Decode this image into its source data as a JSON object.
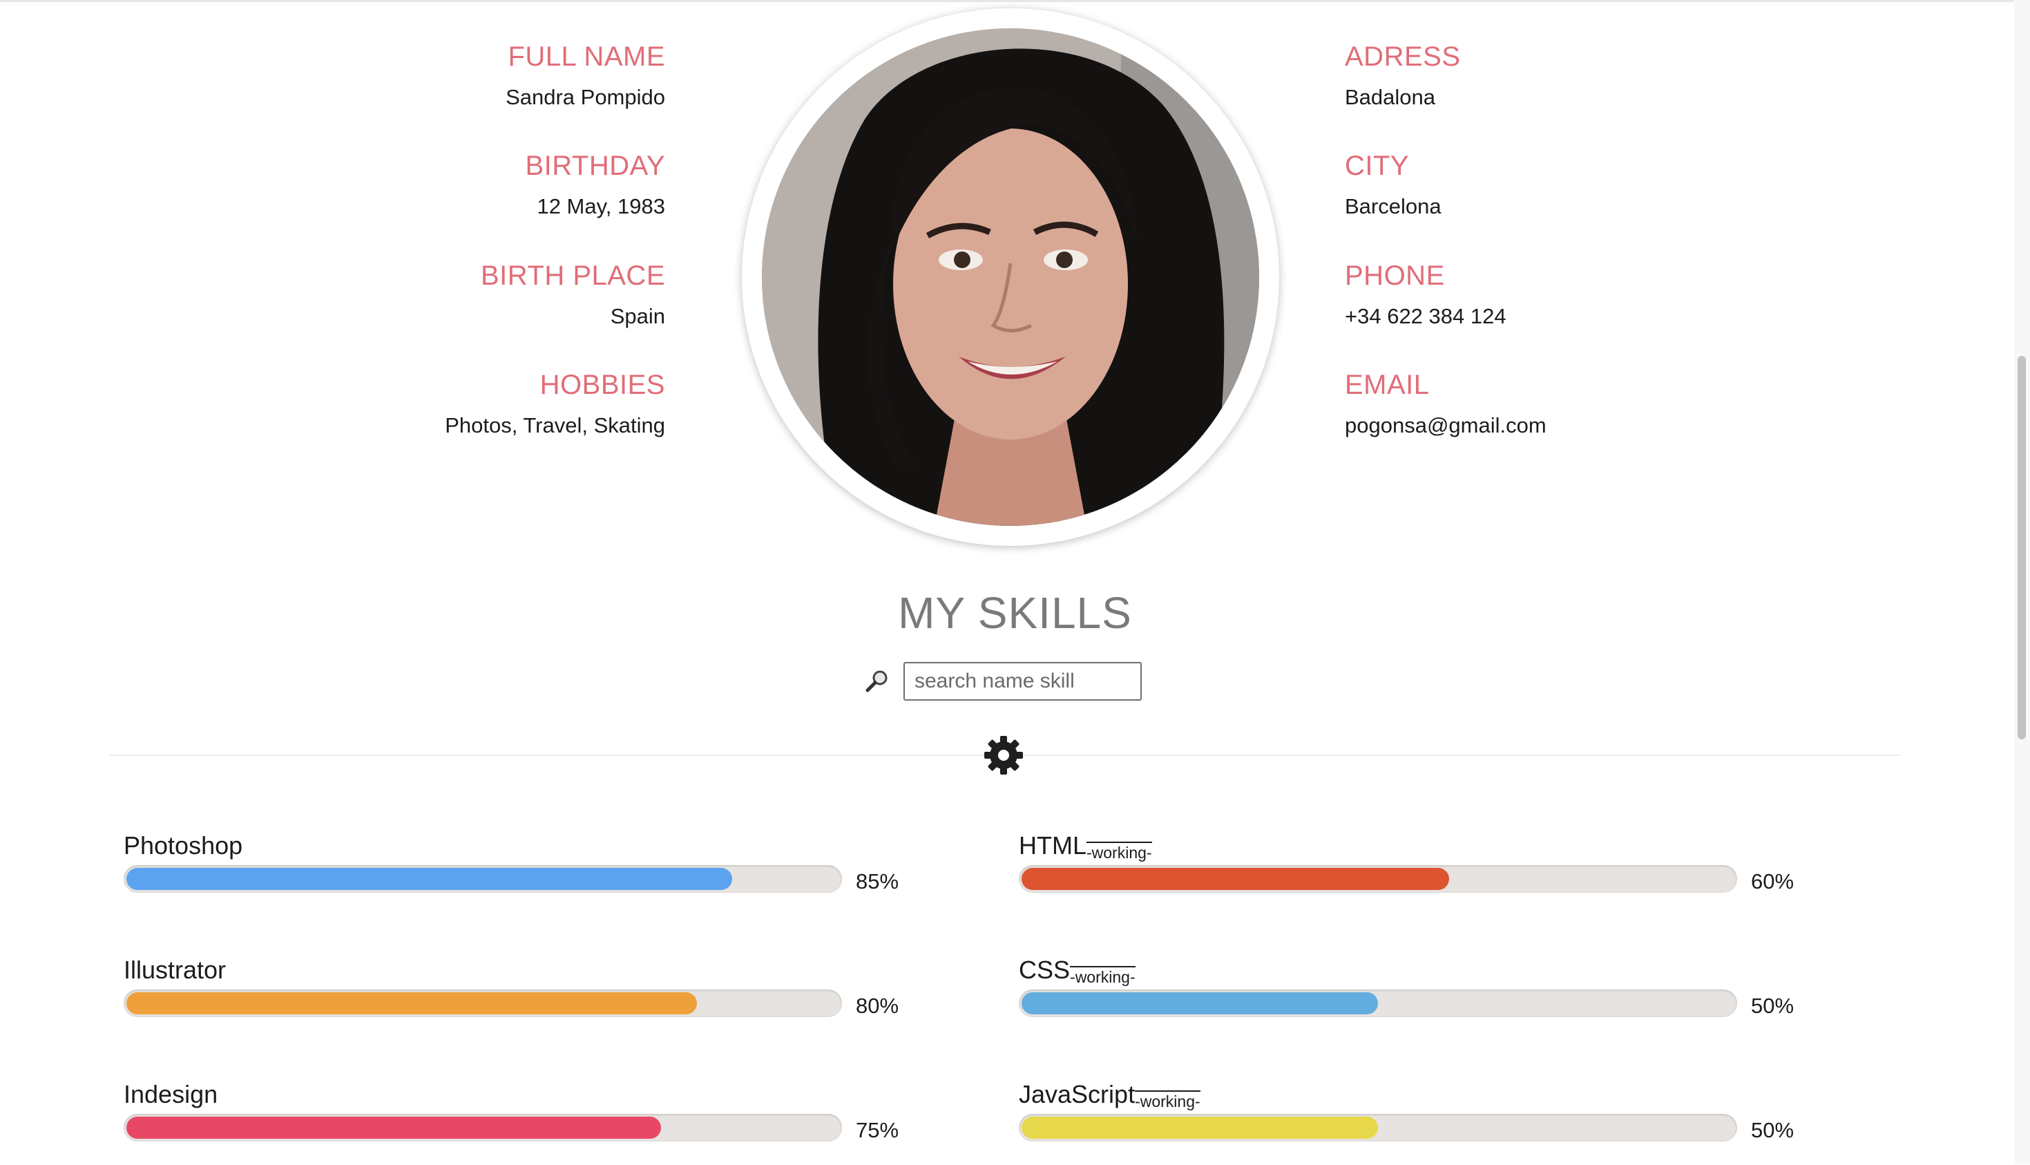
{
  "profile": {
    "left": [
      {
        "label": "FULL NAME",
        "value": "Sandra Pompido"
      },
      {
        "label": "BIRTHDAY",
        "value": "12 May, 1983"
      },
      {
        "label": "BIRTH PLACE",
        "value": "Spain"
      },
      {
        "label": "HOBBIES",
        "value": "Photos, Travel, Skating"
      }
    ],
    "right": [
      {
        "label": "ADRESS",
        "value": "Badalona"
      },
      {
        "label": "CITY",
        "value": "Barcelona"
      },
      {
        "label": "PHONE",
        "value": "+34 622 384 124"
      },
      {
        "label": "EMAIL",
        "value": "pogonsa@gmail.com"
      }
    ]
  },
  "skills_section": {
    "title": "MY SKILLS",
    "search": {
      "placeholder": "search name skill",
      "value": "",
      "icon": "magnifier-icon"
    },
    "settings_icon": "gear-icon",
    "accent_color": "#e06d78",
    "skills": [
      {
        "name": "Photoshop",
        "badge": "",
        "percent_label": "85%",
        "level": 0.85,
        "color": "#5ba3ef"
      },
      {
        "name": "HTML",
        "badge": "-working-",
        "percent_label": "60%",
        "level": 0.6,
        "color": "#dd5430"
      },
      {
        "name": "Illustrator",
        "badge": "",
        "percent_label": "80%",
        "level": 0.8,
        "color": "#eea13a"
      },
      {
        "name": "CSS",
        "badge": "-working-",
        "percent_label": "50%",
        "level": 0.5,
        "color": "#63acdf"
      },
      {
        "name": "Indesign",
        "badge": "",
        "percent_label": "75%",
        "level": 0.75,
        "color": "#e84865"
      },
      {
        "name": "JavaScript",
        "badge": "-working-",
        "percent_label": "50%",
        "level": 0.5,
        "color": "#e7d84b"
      }
    ]
  }
}
